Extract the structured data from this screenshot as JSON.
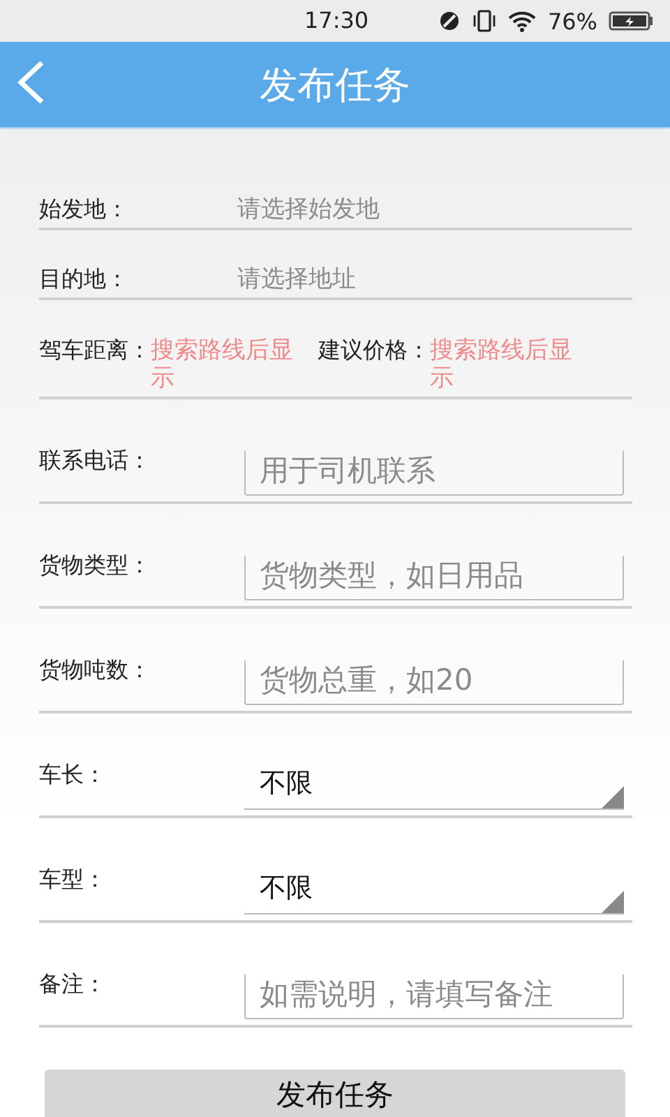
{
  "status_bar": {
    "time": "17:30",
    "battery": "76%"
  },
  "header": {
    "title": "发布任务"
  },
  "form": {
    "rows": [
      {
        "kind": "picker",
        "label": "始发地：",
        "placeholder": "请选择始发地"
      },
      {
        "kind": "picker",
        "label": "目的地：",
        "placeholder": "请选择地址"
      },
      {
        "kind": "info",
        "items": [
          {
            "label": "驾车距离：",
            "value": "搜索路线后显示"
          },
          {
            "label": "建议价格：",
            "value": "搜索路线后显示"
          }
        ]
      },
      {
        "kind": "input",
        "label": "联系电话：",
        "placeholder": "用于司机联系"
      },
      {
        "kind": "input",
        "label": "货物类型：",
        "placeholder": "货物类型，如日用品"
      },
      {
        "kind": "input",
        "label": "货物吨数：",
        "placeholder": "货物总重，如20"
      },
      {
        "kind": "select",
        "label": "车长：",
        "value": "不限"
      },
      {
        "kind": "select",
        "label": "车型：",
        "value": "不限"
      },
      {
        "kind": "input",
        "label": "备注：",
        "placeholder": "如需说明，请填写备注"
      }
    ]
  },
  "submit_button": "发布任务"
}
